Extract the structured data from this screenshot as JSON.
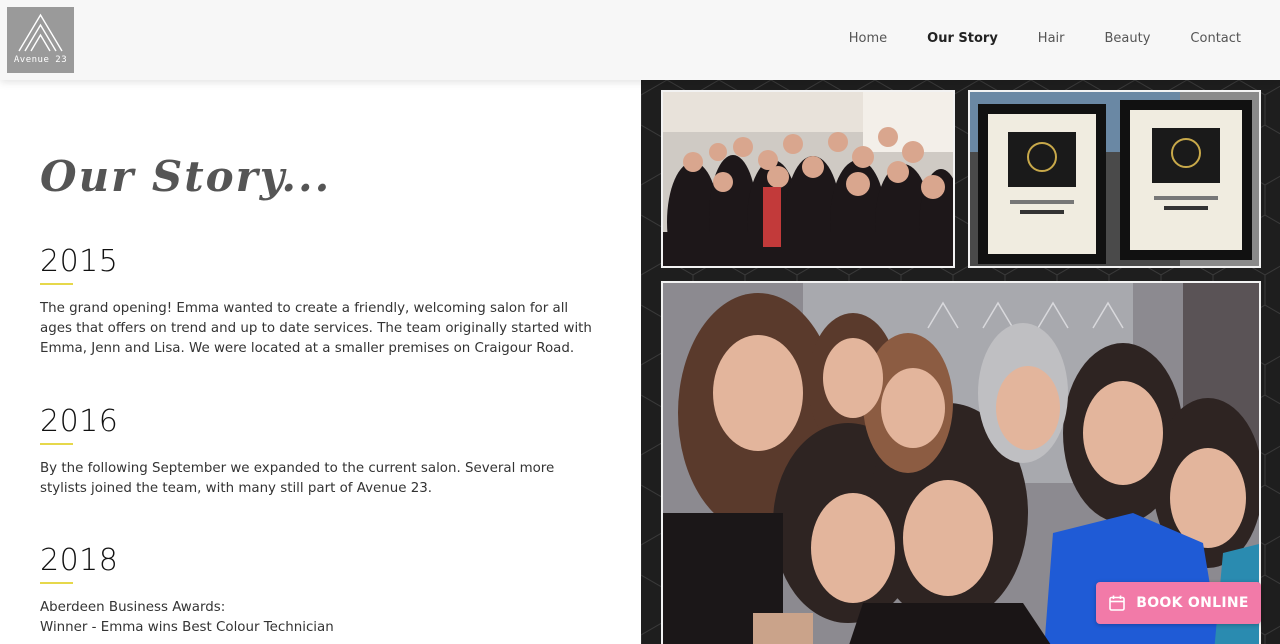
{
  "header": {
    "logo_text": "Avenue 23",
    "nav": [
      {
        "label": "Home",
        "active": false
      },
      {
        "label": "Our Story",
        "active": true
      },
      {
        "label": "Hair",
        "active": false
      },
      {
        "label": "Beauty",
        "active": false
      },
      {
        "label": "Contact",
        "active": false
      }
    ]
  },
  "main": {
    "title": "Our Story...",
    "sections": [
      {
        "year": "2015",
        "text": "The grand opening! Emma wanted to create a friendly, welcoming salon for all ages that offers on trend and up to date services. The team originally started with Emma, Jenn and Lisa. We were located at a smaller premises on Craigour Road."
      },
      {
        "year": "2016",
        "text": "By the following September we expanded to the current salon. Several more stylists joined the team, with many still part of Avenue 23."
      },
      {
        "year": "2018",
        "lines": [
          "Aberdeen Business Awards:",
          "Winner - Emma wins Best Colour Technician"
        ]
      }
    ]
  },
  "book_button": {
    "label": "BOOK ONLINE"
  },
  "colors": {
    "accent_underline": "#e6d84b",
    "book_button": "#f27aa8",
    "gallery_bg": "#1e1e1e"
  },
  "icons": {
    "logo": "triangle-logo-icon",
    "book": "calendar-icon"
  }
}
